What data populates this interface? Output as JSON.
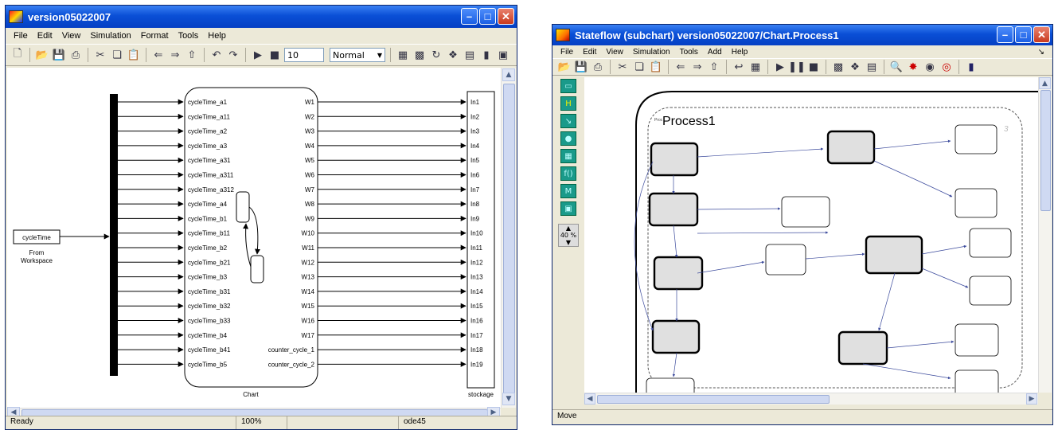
{
  "window1": {
    "title": "version05022007",
    "menu": [
      "File",
      "Edit",
      "View",
      "Simulation",
      "Format",
      "Tools",
      "Help"
    ],
    "stop_time": "10",
    "sim_mode": "Normal",
    "source_block": {
      "label": "cycleTime",
      "caption_line1": "From",
      "caption_line2": "Workspace"
    },
    "chart": {
      "title": "Chart",
      "inputs": [
        "cycleTime_a1",
        "cycleTime_a11",
        "cycleTime_a2",
        "cycleTime_a3",
        "cycleTime_a31",
        "cycleTime_a311",
        "cycleTime_a312",
        "cycleTime_a4",
        "cycleTime_b1",
        "cycleTime_b11",
        "cycleTime_b2",
        "cycleTime_b21",
        "cycleTime_b3",
        "cycleTime_b31",
        "cycleTime_b32",
        "cycleTime_b33",
        "cycleTime_b4",
        "cycleTime_b41",
        "cycleTime_b5"
      ],
      "outputs": [
        "W1",
        "W2",
        "W3",
        "W4",
        "W5",
        "W6",
        "W7",
        "W8",
        "W9",
        "W10",
        "W11",
        "W12",
        "W13",
        "W14",
        "W15",
        "W16",
        "W17",
        "counter_cycle_1",
        "counter_cycle_2"
      ]
    },
    "sink": {
      "label": "stockage",
      "ports": [
        "In1",
        "In2",
        "In3",
        "In4",
        "In5",
        "In6",
        "In7",
        "In8",
        "In9",
        "In10",
        "In11",
        "In12",
        "In13",
        "In14",
        "In15",
        "In16",
        "In17",
        "In18",
        "In19"
      ]
    },
    "status": {
      "text": "Ready",
      "zoom": "100%",
      "solver": "ode45"
    }
  },
  "window2": {
    "title": "Stateflow (subchart) version05022007/Chart.Process1",
    "menu": [
      "File",
      "Edit",
      "View",
      "Simulation",
      "Tools",
      "Add",
      "Help"
    ],
    "zoom": "40 %",
    "state_title": "Process1",
    "count": "3",
    "status": "Move"
  }
}
